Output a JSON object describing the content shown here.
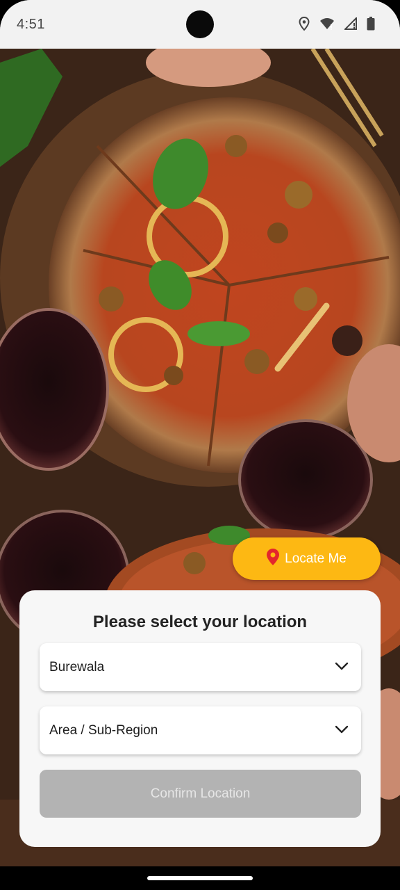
{
  "status_bar": {
    "time": "4:51",
    "icons": [
      "location-icon",
      "wifi-icon",
      "signal-icon",
      "battery-icon"
    ]
  },
  "background": {
    "description_icon": "pizza-photo"
  },
  "locate_button": {
    "label": "Locate Me",
    "icon": "map-pin-icon",
    "color": "#fdb813",
    "pin_color": "#e3262c"
  },
  "location_sheet": {
    "title": "Please select your location",
    "city_select": {
      "value": "Burewala"
    },
    "area_select": {
      "value": "Area / Sub-Region"
    },
    "confirm_button": {
      "label": "Confirm Location",
      "enabled": false
    }
  }
}
